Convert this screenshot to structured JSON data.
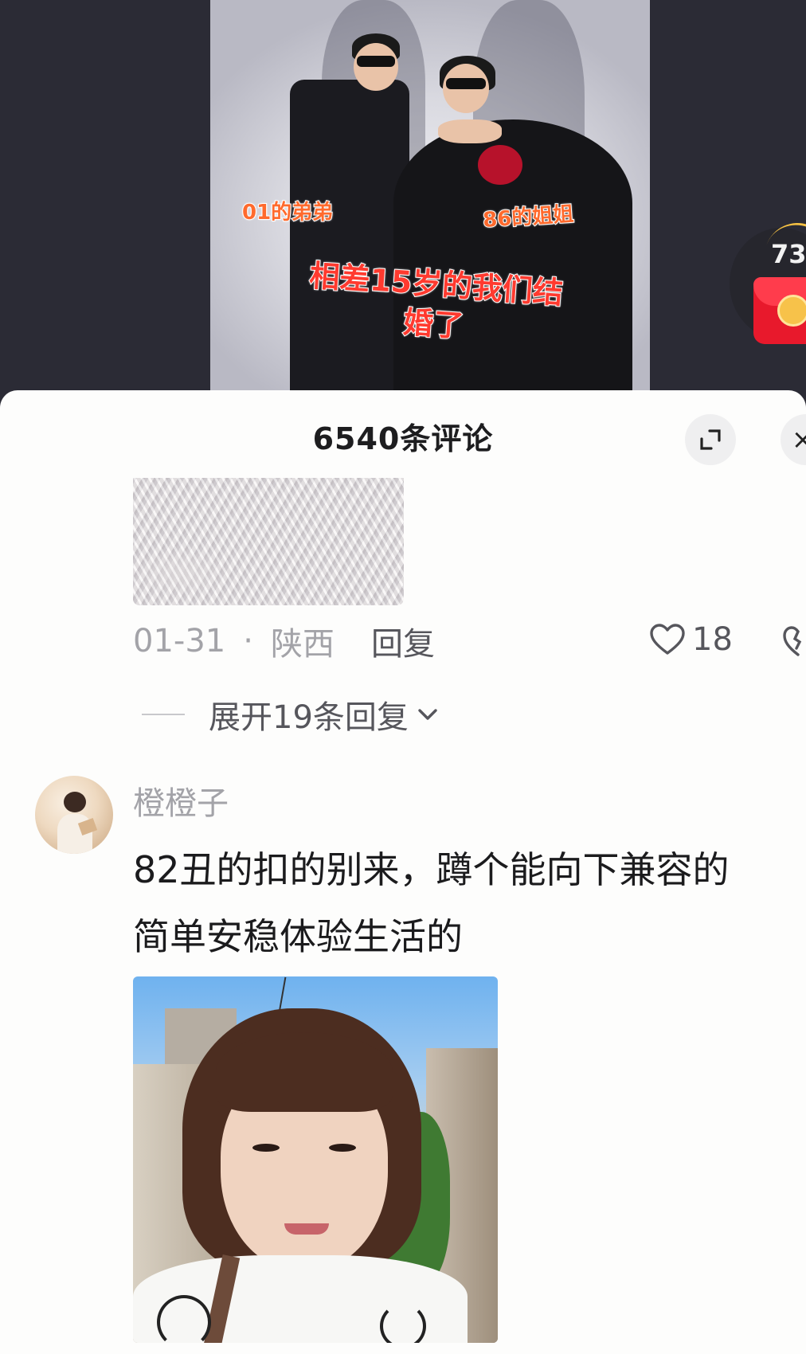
{
  "video": {
    "caption_left": "01的弟弟",
    "caption_right": "86的姐姐",
    "caption_main_line1": "相差15岁的我们结",
    "caption_main_line2": "婚了",
    "badge_count": "73"
  },
  "comments_panel": {
    "title": "6540条评论",
    "expand_icon": "expand-icon",
    "close_label": "×"
  },
  "comment_1": {
    "date": "01-31",
    "dot": "·",
    "location": "陕西",
    "reply_label": "回复",
    "like_count": "18",
    "expand_replies_label": "展开19条回复"
  },
  "comment_2": {
    "username": "橙橙子",
    "text_line1": "82丑的扣的别来，蹲个能向下兼容的",
    "text_line2": "简单安稳体验生活的"
  },
  "colors": {
    "accent_orange": "#ff6a2d",
    "accent_red": "#ff3a2f",
    "text_primary": "#1b1b1d",
    "text_secondary": "#a3a3a8"
  }
}
